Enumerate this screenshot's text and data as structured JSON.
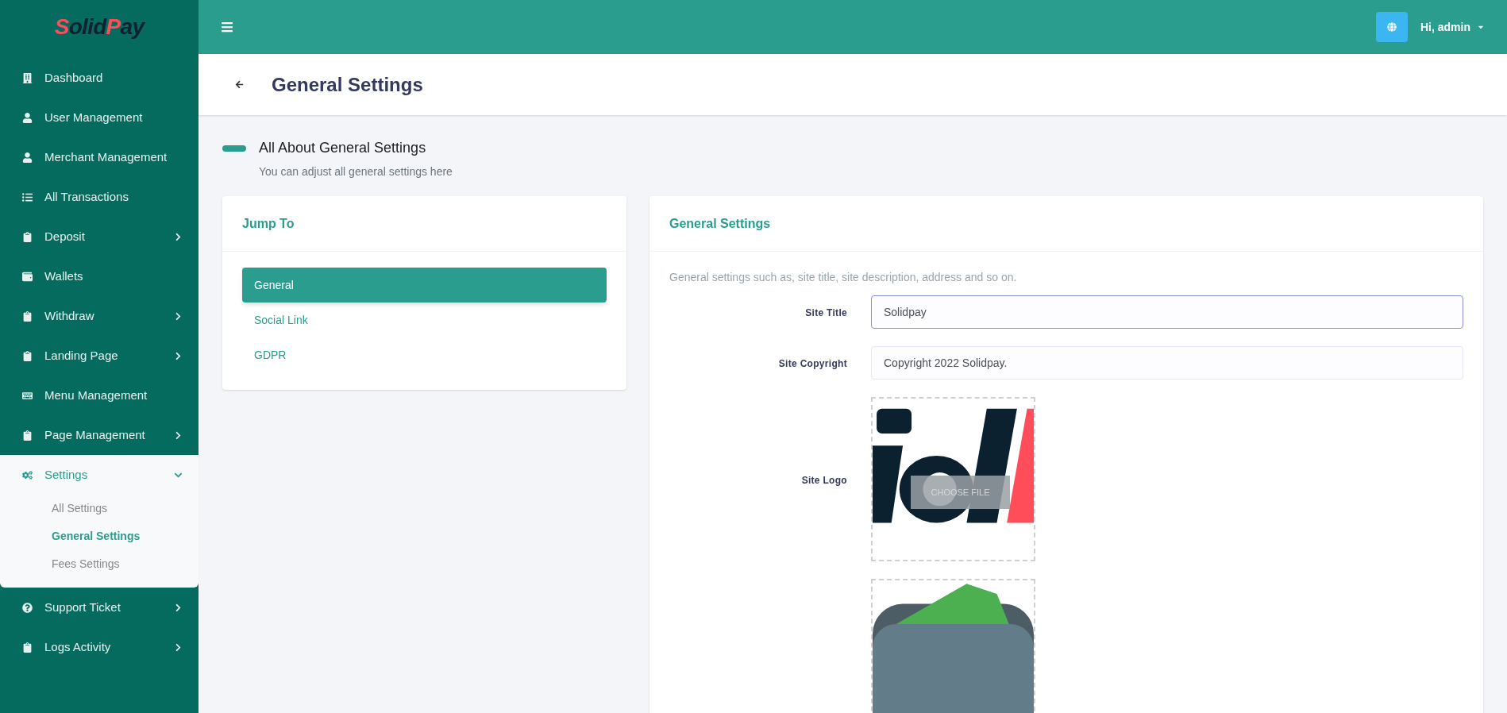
{
  "brand": {
    "parts": [
      {
        "text": "S",
        "accent": true
      },
      {
        "text": "olid",
        "accent": false
      },
      {
        "text": "P",
        "accent": true
      },
      {
        "text": "ay",
        "accent": false
      }
    ]
  },
  "sidebar": {
    "items": [
      {
        "kind": "link",
        "label": "Dashboard",
        "selected": false
      },
      {
        "kind": "link",
        "label": "User Management",
        "selected": false
      },
      {
        "kind": "link",
        "label": "Merchant Management",
        "selected": false
      },
      {
        "kind": "link",
        "label": "All Transactions",
        "selected": false
      },
      {
        "kind": "menu",
        "label": "Deposit",
        "expanded": false,
        "selected": false
      },
      {
        "kind": "link",
        "label": "Wallets",
        "selected": false
      },
      {
        "kind": "menu",
        "label": "Withdraw",
        "expanded": false,
        "selected": false
      },
      {
        "kind": "menu",
        "label": "Landing Page",
        "expanded": false,
        "selected": false
      },
      {
        "kind": "link",
        "label": "Menu Management",
        "selected": false
      },
      {
        "kind": "menu",
        "label": "Page Management",
        "expanded": false,
        "selected": false
      },
      {
        "kind": "menu",
        "label": "Settings",
        "expanded": true,
        "selected": true,
        "children": [
          {
            "label": "All Settings",
            "selected": false
          },
          {
            "label": "General Settings",
            "selected": true
          },
          {
            "label": "Fees Settings",
            "selected": false
          }
        ]
      },
      {
        "kind": "menu",
        "label": "Support Ticket",
        "expanded": false,
        "selected": false
      },
      {
        "kind": "menu",
        "label": "Logs Activity",
        "expanded": false,
        "selected": false
      }
    ]
  },
  "topbar": {
    "user": "Hi, admin"
  },
  "page_header": {
    "title": "General Settings"
  },
  "section": {
    "title": "All About General Settings",
    "subtitle": "You can adjust all general settings here"
  },
  "jump_to": {
    "title": "Jump To",
    "items": [
      {
        "label": "General",
        "selected": true
      },
      {
        "label": "Social Link",
        "selected": false
      },
      {
        "label": "GDPR",
        "selected": false
      }
    ]
  },
  "settings_card": {
    "title": "General Settings",
    "description": "General settings such as, site title, site description, address and so on.",
    "fields": [
      {
        "kind": "text",
        "label": "Site Title",
        "value": "Solidpay",
        "focused": true
      },
      {
        "kind": "text",
        "label": "Site Copyright",
        "value": "Copyright 2022 Solidpay.",
        "focused": false
      },
      {
        "label": "Site Logo",
        "button": "CHOOSE FILE"
      },
      {
        "kind": "image2"
      }
    ]
  }
}
